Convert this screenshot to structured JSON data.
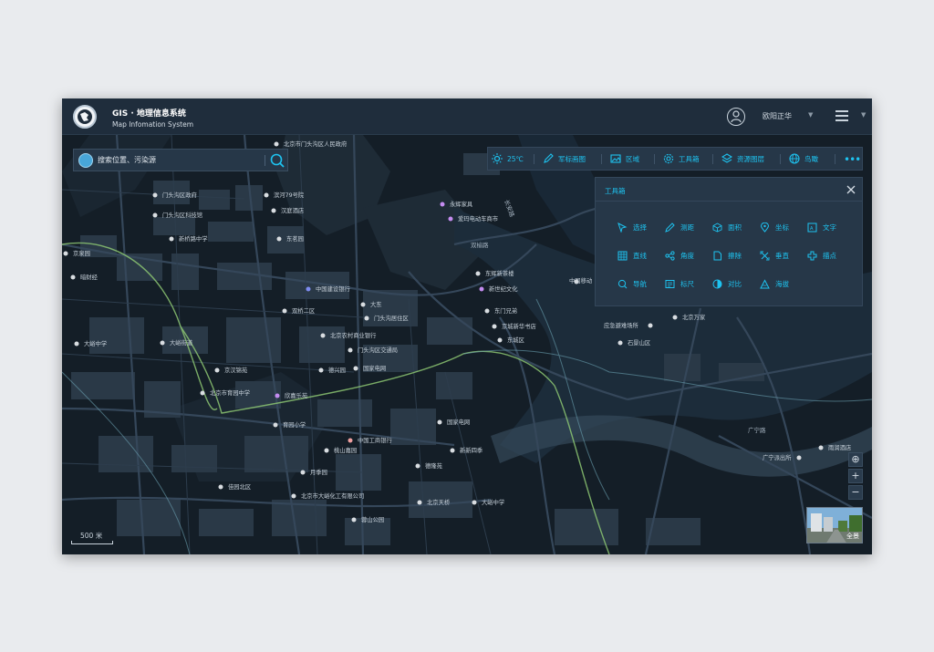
{
  "header": {
    "title": "GIS · 地理信息系统",
    "subtitle": "Map Infomation System",
    "user_name": "欧阳正华"
  },
  "search": {
    "placeholder": "搜索位置、污染源"
  },
  "toolbar": {
    "weather": "25℃",
    "items": [
      "军标画图",
      "区域",
      "工具箱",
      "资源图层",
      "鸟瞰"
    ]
  },
  "toolbox": {
    "title": "工具箱",
    "tools": [
      "选择",
      "测距",
      "面积",
      "坐标",
      "文字",
      "直线",
      "角度",
      "擦除",
      "垂直",
      "描点",
      "导航",
      "标尺",
      "对比",
      "海拔"
    ]
  },
  "map": {
    "scale_label": "500 米",
    "streetview_label": "全景",
    "roads": [
      "双榆路",
      "广宁路",
      "长安路"
    ],
    "pois": [
      "北京市门头沟区人民政府",
      "门头沟区政府",
      "门头沟区科技馆",
      "滨河79号院",
      "汉庭酒店",
      "新桥路中学",
      "东茗园",
      "永辉家具",
      "爱玛电动车商市",
      "东辉新茶楼",
      "双桥门诊部",
      "门头沟区",
      "东陶国际",
      "京城新华书店",
      "东城区",
      "北京万家",
      "中国移动",
      "东门兄弟",
      "府城三区",
      "门头沟区交通局",
      "应急避难场所",
      "石景山区",
      "北京市第八中学",
      "京汉锦苑",
      "东庆园",
      "国家电网",
      "北京市育园中学",
      "欣嘉乐苑",
      "中国建设银行",
      "大东",
      "双桥二区",
      "北京农村商业银行",
      "门头沟居住区",
      "门头沟区交通局",
      "德兴园",
      "国家电网",
      "中国工商银行",
      "广宁派出所",
      "新新四季",
      "大峪中学",
      "北京市育园小学",
      "石景山区",
      "月季园",
      "中国工商银行",
      "北京天桥",
      "北京市大峪化工有限公司",
      "大峪中学",
      "蓉山公园",
      "佳园北区",
      "雨润酒店"
    ]
  }
}
